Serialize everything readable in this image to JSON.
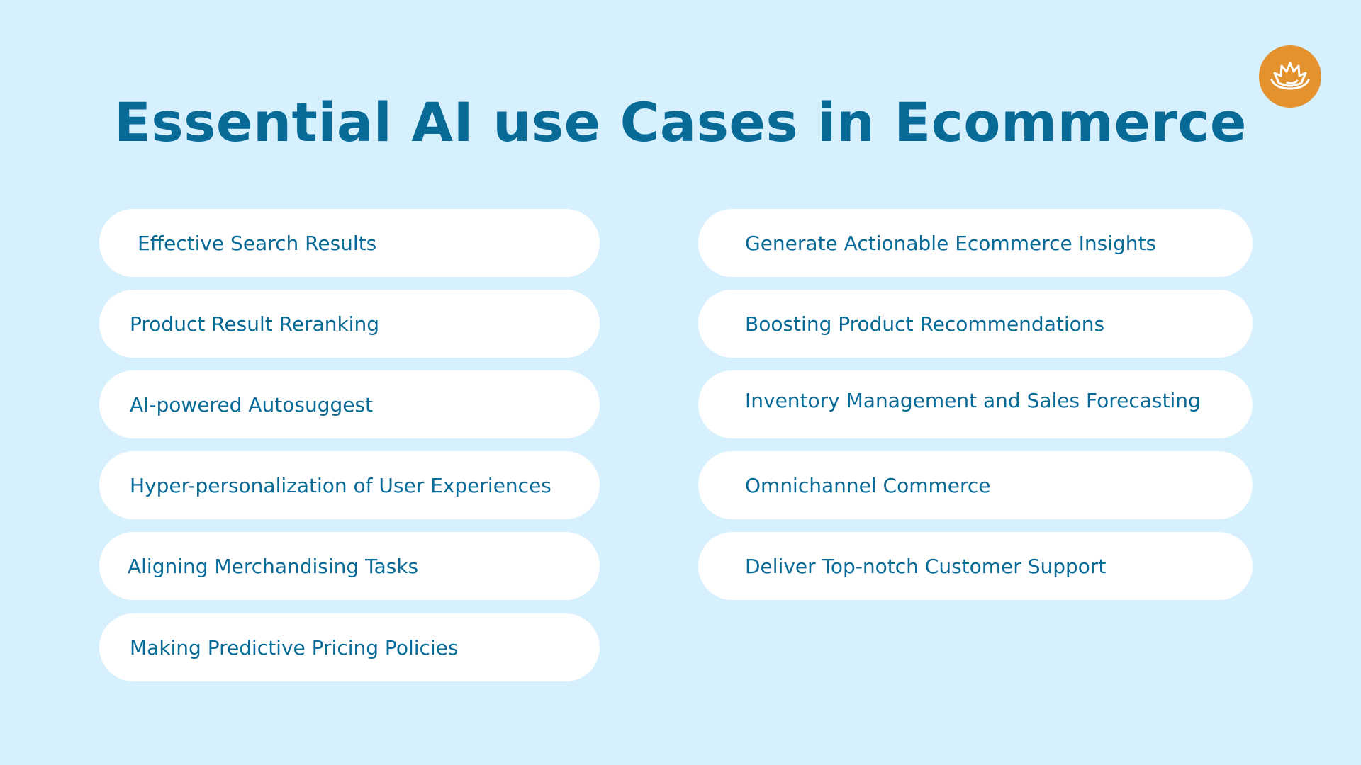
{
  "title": "Essential AI use Cases in Ecommerce",
  "logo": {
    "icon": "lotus-icon",
    "color": "#e3922e"
  },
  "colors": {
    "background": "#d7f0fd",
    "text": "#076a97",
    "pill": "#ffffff"
  },
  "left_items": [
    {
      "label": "Effective Search Results"
    },
    {
      "label": "Product Result Reranking"
    },
    {
      "label": "AI-powered Autosuggest"
    },
    {
      "label": "Hyper-personalization of User Experiences"
    },
    {
      "label": "Aligning Merchandising Tasks"
    },
    {
      "label": "Making Predictive Pricing Policies"
    }
  ],
  "right_items": [
    {
      "label": "Generate Actionable Ecommerce Insights"
    },
    {
      "label": "Boosting Product Recommendations"
    },
    {
      "label": "Inventory Management and Sales Forecasting"
    },
    {
      "label": "Omnichannel Commerce"
    },
    {
      "label": "Deliver Top-notch Customer Support"
    }
  ]
}
